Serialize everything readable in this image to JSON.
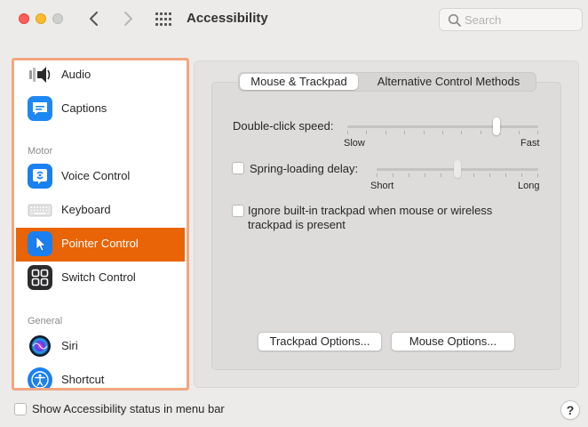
{
  "window": {
    "title": "Accessibility",
    "search_placeholder": "Search"
  },
  "sidebar": {
    "items": [
      {
        "label": "Audio",
        "icon": "speaker-icon"
      },
      {
        "label": "Captions",
        "icon": "captions-icon"
      },
      {
        "label": "Voice Control",
        "icon": "voice-control-icon"
      },
      {
        "label": "Keyboard",
        "icon": "keyboard-icon"
      },
      {
        "label": "Pointer Control",
        "icon": "pointer-icon",
        "selected": true
      },
      {
        "label": "Switch Control",
        "icon": "switch-control-icon"
      },
      {
        "label": "Siri",
        "icon": "siri-icon"
      },
      {
        "label": "Shortcut",
        "icon": "accessibility-shortcut-icon"
      }
    ],
    "sections": {
      "motor": "Motor",
      "general": "General"
    }
  },
  "tabs": {
    "mouse_trackpad": "Mouse & Trackpad",
    "alternative": "Alternative Control Methods",
    "active": "Mouse & Trackpad"
  },
  "settings": {
    "double_click": {
      "label": "Double-click speed:",
      "min_label": "Slow",
      "max_label": "Fast",
      "value_fraction": 0.79
    },
    "spring_loading": {
      "label": "Spring-loading delay:",
      "min_label": "Short",
      "max_label": "Long",
      "value_fraction": 0.5,
      "checked": false
    },
    "ignore_trackpad": {
      "label_line1": "Ignore built-in trackpad when mouse or wireless",
      "label_line2": "trackpad is present",
      "checked": false
    }
  },
  "buttons": {
    "trackpad_options": "Trackpad Options...",
    "mouse_options": "Mouse Options..."
  },
  "footer": {
    "status_label": "Show Accessibility status in menu bar",
    "status_checked": false,
    "help": "?"
  },
  "colors": {
    "accent": "#e96406",
    "sidebar_border": "#f1a77f",
    "close": "#fe5f57",
    "minimize": "#febc2e"
  }
}
